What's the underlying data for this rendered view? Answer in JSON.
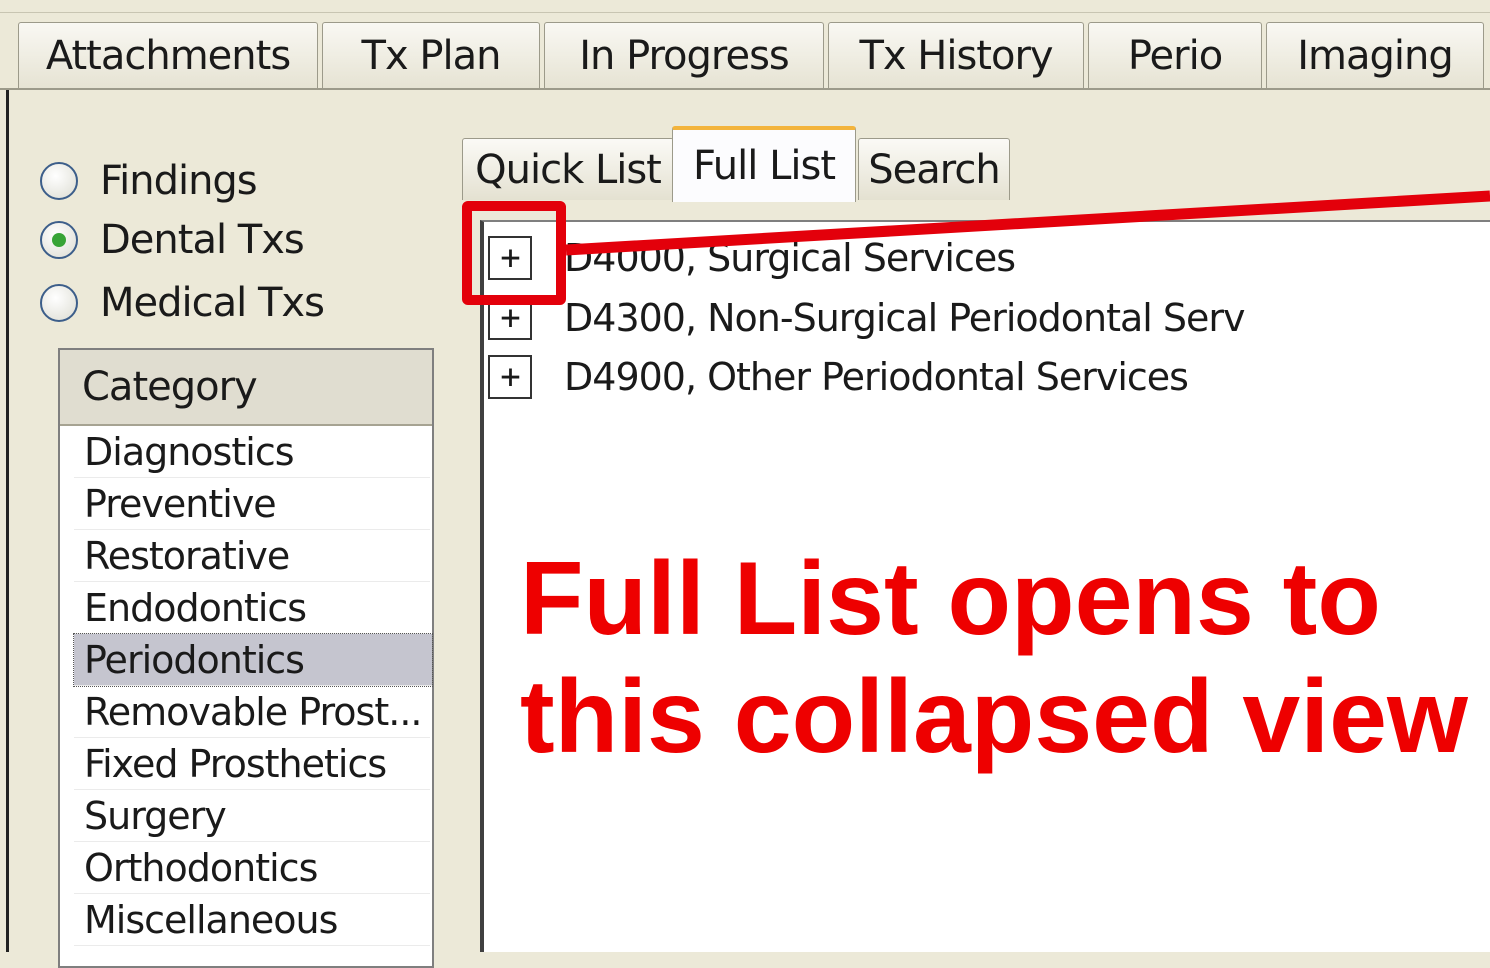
{
  "top_tabs": [
    "Attachments",
    "Tx Plan",
    "In Progress",
    "Tx History",
    "Perio",
    "Imaging"
  ],
  "radio_options": [
    {
      "label": "Findings",
      "selected": false
    },
    {
      "label": "Dental Txs",
      "selected": true
    },
    {
      "label": "Medical Txs",
      "selected": false
    }
  ],
  "category": {
    "header": "Category",
    "items": [
      "Diagnostics",
      "Preventive",
      "Restorative",
      "Endodontics",
      "Periodontics",
      "Removable Prost...",
      "Fixed Prosthetics",
      "Surgery",
      "Orthodontics",
      "Miscellaneous"
    ],
    "selected": "Periodontics"
  },
  "sub_tabs": {
    "quick_list": "Quick List",
    "full_list": "Full List",
    "search": "Search",
    "active": "Full List"
  },
  "tree": [
    {
      "expander": "+",
      "label": "D4000, Surgical Services"
    },
    {
      "expander": "+",
      "label": "D4300, Non-Surgical Periodontal Serv"
    },
    {
      "expander": "+",
      "label": "D4900, Other Periodontal Services"
    }
  ],
  "annotation": {
    "line1": "Full List opens to",
    "line2": "this collapsed view",
    "color": "#ee0000"
  }
}
